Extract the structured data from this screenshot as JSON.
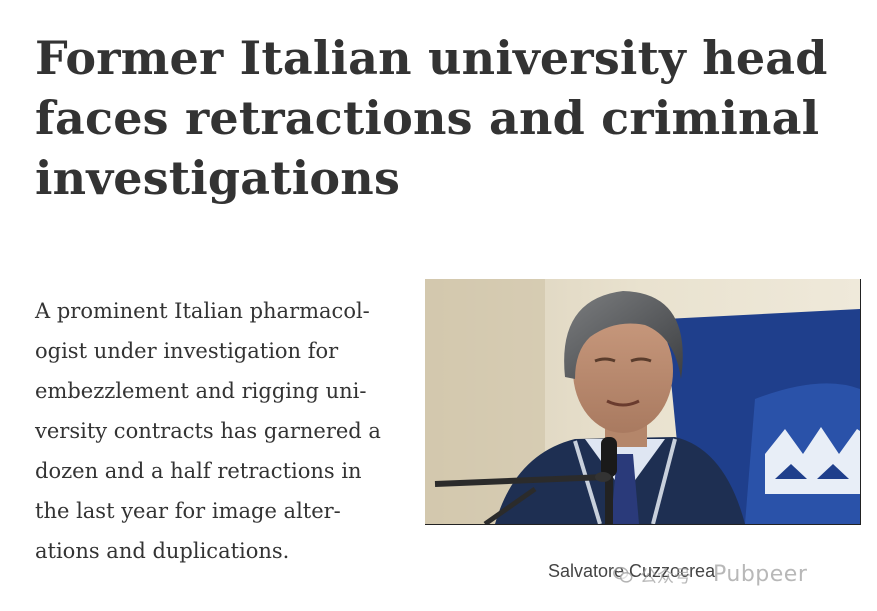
{
  "article": {
    "headline_lines": [
      "Former Italian university head",
      "faces retractions and criminal",
      "investigations"
    ],
    "lede_lines": [
      "A prominent Italian pharmacol-",
      "ogist under investigation for",
      "embezzlement and rigging uni-",
      "versity contracts has garnered a",
      "dozen and a half retractions in",
      "the last year for image alter-",
      "ations and duplications."
    ],
    "photo": {
      "caption": "Salvatore Cuzzocrea"
    }
  },
  "watermark": {
    "icon": "wechat-icon",
    "channel_label": "公众号",
    "account_name": "Pubpeer"
  },
  "colors": {
    "text": "#333333",
    "photo_backdrop_blue": "#1f3f8c",
    "suit": "#1e2f52"
  }
}
